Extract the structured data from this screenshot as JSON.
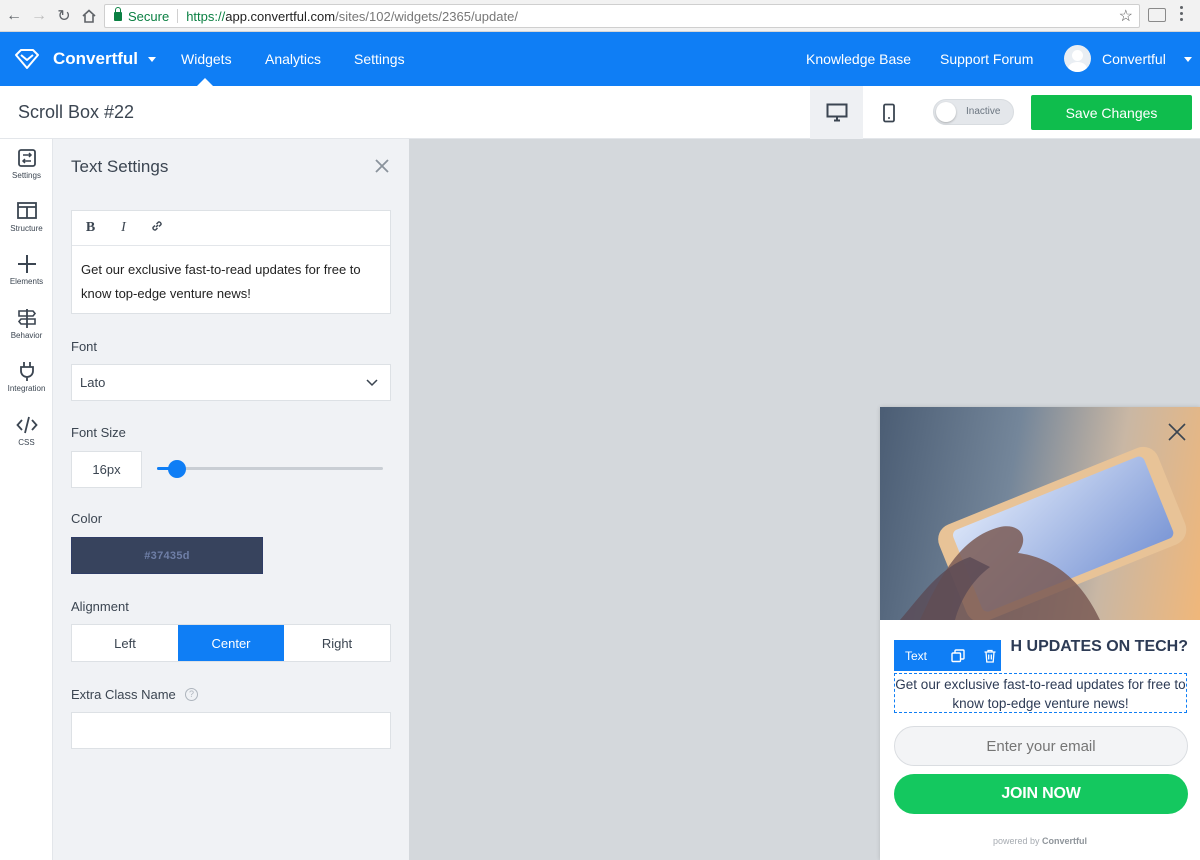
{
  "browser": {
    "secure_label": "Secure",
    "url_scheme": "https://",
    "url_host": "app.convertful.com",
    "url_path": "/sites/102/widgets/2365/update/"
  },
  "topnav": {
    "brand": "Convertful",
    "links": [
      "Widgets",
      "Analytics",
      "Settings"
    ],
    "active_link": "Widgets",
    "right_links": [
      "Knowledge Base",
      "Support Forum"
    ],
    "user_name": "Convertful"
  },
  "subheader": {
    "widget_title": "Scroll Box #22",
    "status_toggle_label": "Inactive",
    "save_label": "Save Changes"
  },
  "rail": {
    "items": [
      "Settings",
      "Structure",
      "Elements",
      "Behavior",
      "Integration",
      "CSS"
    ]
  },
  "panel": {
    "title": "Text Settings",
    "editor_text": "Get our exclusive fast-to-read updates for free to know top-edge venture news!",
    "font_label": "Font",
    "font_value": "Lato",
    "font_size_label": "Font Size",
    "font_size_value": "16px",
    "font_size_slider_fraction": 0.09,
    "color_label": "Color",
    "color_value": "#37435d",
    "alignment_label": "Alignment",
    "alignment_options": [
      "Left",
      "Center",
      "Right"
    ],
    "alignment_selected": "Center",
    "extra_class_label": "Extra Class Name",
    "extra_class_value": "",
    "help_glyph": "?"
  },
  "widget": {
    "heading": "H UPDATES ON TECH?",
    "text": "Get our exclusive fast-to-read updates for free to know top-edge venture news!",
    "element_toolbar_label": "Text",
    "email_placeholder": "Enter your email",
    "button_label": "JOIN NOW",
    "powered_prefix": "powered by",
    "powered_brand": "Convertful"
  },
  "colors": {
    "brand_blue": "#0f7ef5",
    "save_green": "#0fbd4d",
    "join_green": "#14c85f",
    "text_color_swatch": "#37435d"
  }
}
